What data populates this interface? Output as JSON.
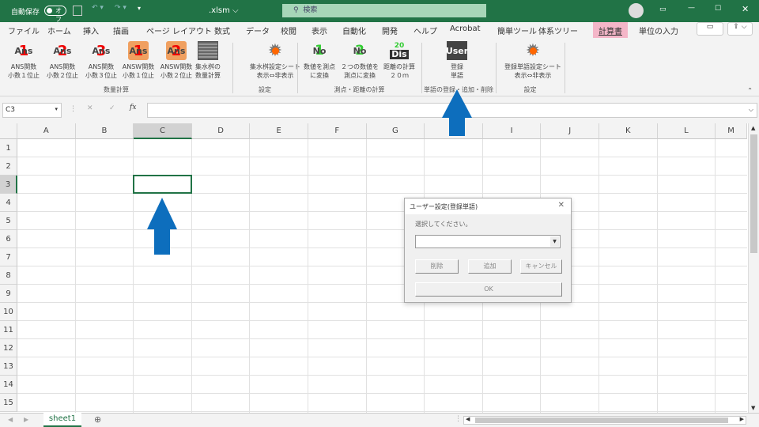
{
  "titlebar": {
    "autosave": "自動保存",
    "toggle": "オフ",
    "filename": ".xlsm",
    "search_placeholder": "検索"
  },
  "tabs": [
    "ファイル",
    "ホーム",
    "挿入",
    "描画",
    "ページ レイアウト",
    "数式",
    "データ",
    "校閲",
    "表示",
    "自動化",
    "開発",
    "ヘルプ",
    "Acrobat",
    "簡単ツール",
    "体系ツリー",
    "計算書",
    "単位の入力"
  ],
  "active_tab": "計算書",
  "ribbon": {
    "buttons": [
      {
        "icon": "Ans",
        "num": "1",
        "l1": "ANS関数",
        "l2": "小数１位止"
      },
      {
        "icon": "Ans",
        "num": "2",
        "l1": "ANS関数",
        "l2": "小数２位止"
      },
      {
        "icon": "Ans",
        "num": "3",
        "l1": "ANS関数",
        "l2": "小数３位止"
      },
      {
        "icon": "Ans",
        "num": "1",
        "l1": "ANSW関数",
        "l2": "小数１位止"
      },
      {
        "icon": "Ans",
        "num": "2",
        "l1": "ANSW関数",
        "l2": "小数２位止"
      },
      {
        "icon": "grid",
        "num": "",
        "l1": "集水桝の",
        "l2": "数量計算"
      },
      {
        "icon": "gear",
        "num": "",
        "l1": "集水桝設定シート",
        "l2": "表示⇔非表示"
      },
      {
        "icon": "No",
        "num": "1",
        "l1": "数値を測点",
        "l2": "に変換"
      },
      {
        "icon": "No",
        "num": "2",
        "l1": "２つの数値を",
        "l2": "測点に変換"
      },
      {
        "icon": "Dis",
        "num": "20",
        "l1": "距離の計算",
        "l2": "２０ｍ"
      },
      {
        "icon": "User",
        "num": "",
        "l1": "登録",
        "l2": "単語"
      },
      {
        "icon": "gear",
        "num": "",
        "l1": "登録単語設定シート",
        "l2": "表示⇔非表示"
      }
    ],
    "groups": [
      "数量計算",
      "設定",
      "測点・距離の計算",
      "単語の登録・追加・削除",
      "設定"
    ]
  },
  "formula_bar": {
    "name_box": "C3",
    "fx": "fx",
    "value": ""
  },
  "columns": [
    "A",
    "B",
    "C",
    "D",
    "E",
    "F",
    "G",
    "H",
    "I",
    "J",
    "K",
    "L",
    "M"
  ],
  "rows": [
    "1",
    "2",
    "3",
    "4",
    "5",
    "6",
    "7",
    "8",
    "9",
    "10",
    "11",
    "12",
    "13",
    "14",
    "15"
  ],
  "selected_cell": "C3",
  "dialog": {
    "title": "ユーザー設定(登録単語)",
    "prompt": "選択してください。",
    "combo_value": "",
    "delete": "削除",
    "add": "追加",
    "cancel": "キャンセル",
    "ok": "OK"
  },
  "sheets": [
    "sheet1"
  ],
  "colors": {
    "excel_green": "#217346",
    "arrow_blue": "#0d6ebd",
    "active_tab_bg": "#f4b6c8"
  }
}
